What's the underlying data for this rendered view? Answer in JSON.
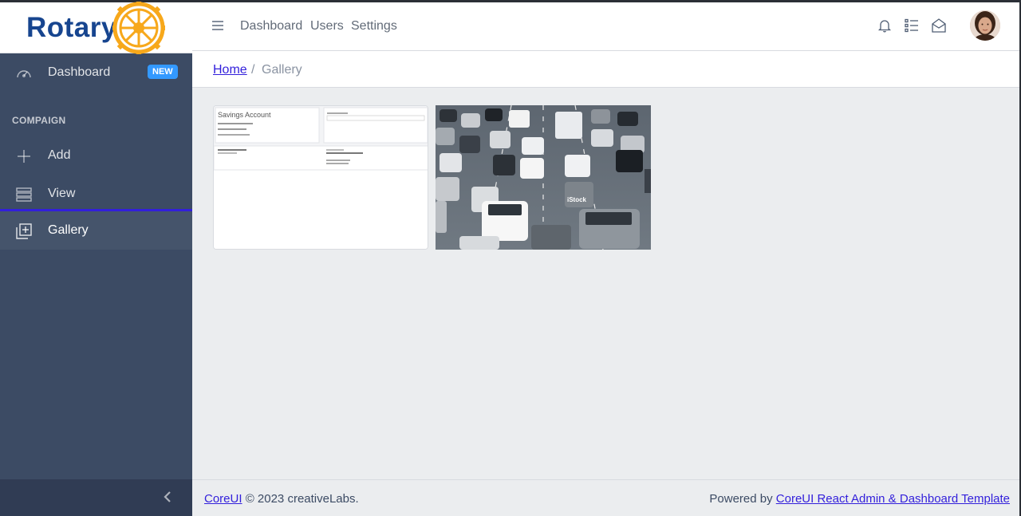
{
  "brand": {
    "name": "Rotary",
    "logo_icon": "rotary-wheel-icon",
    "logo_color": "#f7a81b",
    "name_color": "#17458f"
  },
  "sidebar": {
    "bg_color": "#3c4b64",
    "items": [
      {
        "label": "Dashboard",
        "icon": "speedometer-icon",
        "badge": "NEW"
      }
    ],
    "section_title": "COMPAIGN",
    "section_items": [
      {
        "label": "Add",
        "icon": "plus-icon"
      },
      {
        "label": "View",
        "icon": "list-icon"
      },
      {
        "label": "Gallery",
        "icon": "gallery-icon",
        "active": true
      }
    ],
    "toggler_icon": "chevron-left-icon"
  },
  "header": {
    "menu_icon": "hamburger-icon",
    "nav": [
      "Dashboard",
      "Users",
      "Settings"
    ],
    "icons": [
      "bell-icon",
      "task-list-icon",
      "envelope-open-icon"
    ],
    "avatar": "user-avatar"
  },
  "breadcrumb": {
    "home": "Home",
    "separator": "/",
    "current": "Gallery"
  },
  "gallery": {
    "items": [
      {
        "type": "document-screenshot",
        "heading": "Savings Account"
      },
      {
        "type": "photo",
        "subject": "traffic-jam",
        "watermark": "iStock"
      }
    ]
  },
  "footer": {
    "left_link": "CoreUI",
    "left_text": "© 2023 creativeLabs.",
    "right_text": "Powered by",
    "right_link": "CoreUI React Admin & Dashboard Template"
  },
  "colors": {
    "accent": "#321fdb",
    "badge": "#3399ff",
    "background": "#ebedef"
  }
}
